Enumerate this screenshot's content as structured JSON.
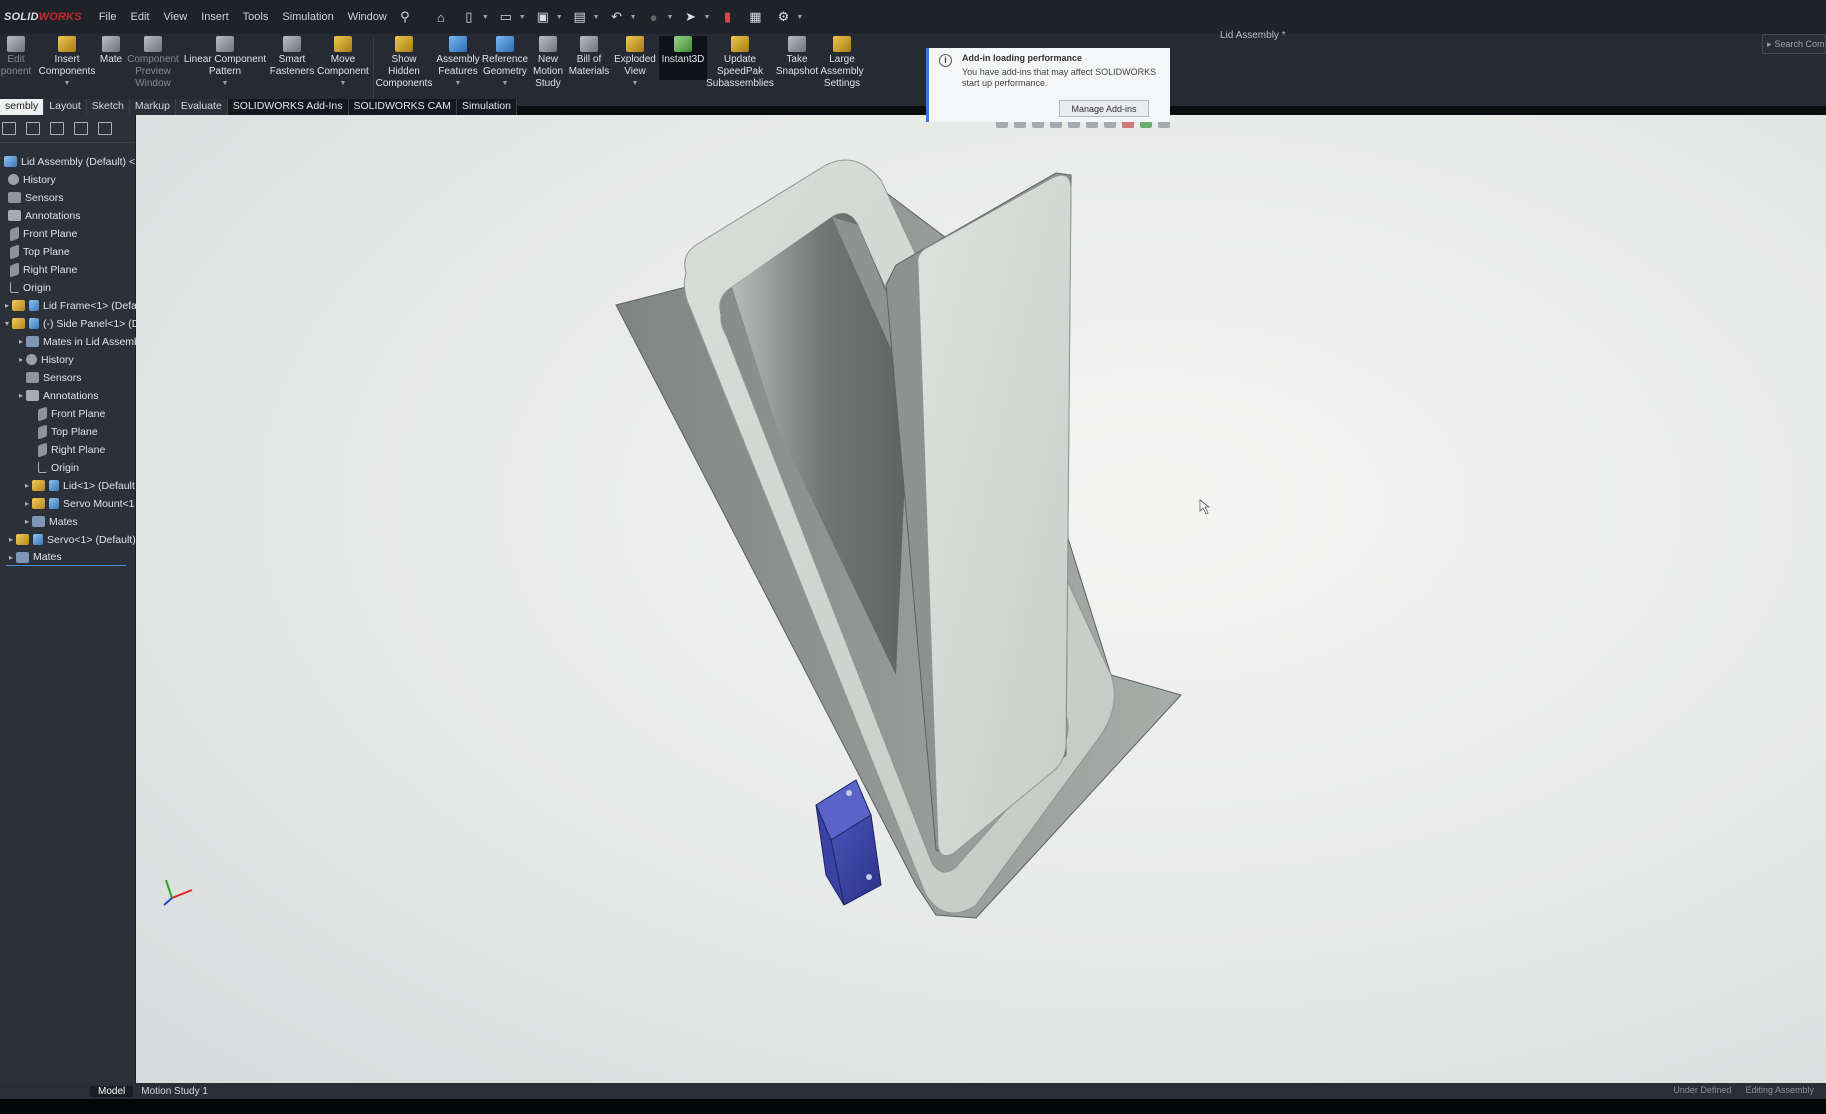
{
  "app": {
    "brand_prefix": "SOLID",
    "brand_suffix": "WORKS",
    "doc_title": "Lid Assembly *",
    "search_placeholder": "Search Com"
  },
  "menu": [
    "File",
    "Edit",
    "View",
    "Insert",
    "Tools",
    "Simulation",
    "Window"
  ],
  "commands": {
    "edit_component": "Edit\nponent",
    "insert_components": "Insert\nComponents",
    "mate": "Mate",
    "component_preview": "Component\nPreview\nWindow",
    "linear_pattern": "Linear Component\nPattern",
    "smart_fasteners": "Smart\nFasteners",
    "move_component": "Move\nComponent",
    "show_hidden": "Show\nHidden\nComponents",
    "assembly_features": "Assembly\nFeatures",
    "reference_geometry": "Reference\nGeometry",
    "new_motion_study": "New\nMotion\nStudy",
    "bill_of_materials": "Bill of\nMaterials",
    "exploded_view": "Exploded\nView",
    "instant3d": "Instant3D",
    "update_speedpak": "Update\nSpeedPak\nSubassemblies",
    "take_snapshot": "Take\nSnapshot",
    "large_assembly": "Large\nAssembly\nSettings"
  },
  "tabs": [
    "sembly",
    "Layout",
    "Sketch",
    "Markup",
    "Evaluate",
    "SOLIDWORKS Add-Ins",
    "SOLIDWORKS CAM",
    "Simulation"
  ],
  "notification": {
    "title": "Add-in loading performance",
    "body": "You have add-ins that may affect SOLIDWORKS start up performance.",
    "button": "Manage Add-ins"
  },
  "tree": {
    "root": "Lid Assembly (Default) <",
    "history": "History",
    "sensors": "Sensors",
    "annotations": "Annotations",
    "front_plane": "Front Plane",
    "top_plane": "Top Plane",
    "right_plane": "Right Plane",
    "origin": "Origin",
    "lid_frame": "Lid Frame<1> (Defa",
    "side_panel": "(-) Side Panel<1> (D",
    "mates_in": "Mates in Lid Assemb",
    "sp_history": "History",
    "sp_sensors": "Sensors",
    "sp_annotations": "Annotations",
    "sp_front": "Front Plane",
    "sp_top": "Top Plane",
    "sp_right": "Right Plane",
    "sp_origin": "Origin",
    "lid": "Lid<1> (Default",
    "servo_mount": "Servo Mount<1",
    "sp_mates": "Mates",
    "servo": "Servo<1> (Default)",
    "mates": "Mates"
  },
  "bottom": {
    "model_tab": "Model",
    "motion_tab": "Motion Study 1",
    "status_left": "Under Defined",
    "status_right": "Editing Assembly"
  }
}
